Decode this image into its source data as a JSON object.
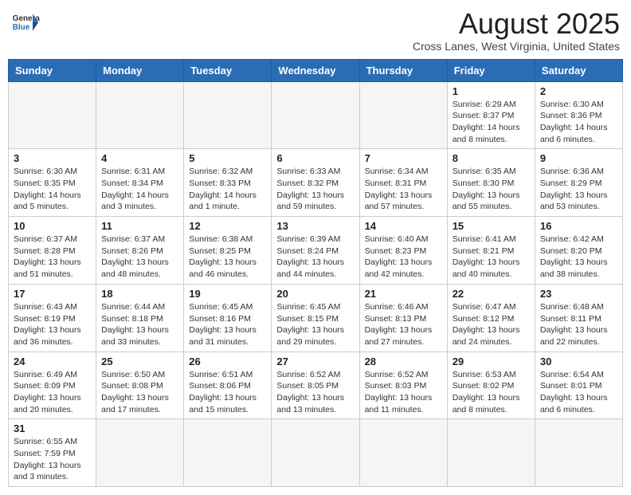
{
  "header": {
    "logo_line1": "General",
    "logo_line2": "Blue",
    "title": "August 2025",
    "subtitle": "Cross Lanes, West Virginia, United States"
  },
  "days_of_week": [
    "Sunday",
    "Monday",
    "Tuesday",
    "Wednesday",
    "Thursday",
    "Friday",
    "Saturday"
  ],
  "weeks": [
    [
      {
        "day": "",
        "info": ""
      },
      {
        "day": "",
        "info": ""
      },
      {
        "day": "",
        "info": ""
      },
      {
        "day": "",
        "info": ""
      },
      {
        "day": "",
        "info": ""
      },
      {
        "day": "1",
        "info": "Sunrise: 6:29 AM\nSunset: 8:37 PM\nDaylight: 14 hours and 8 minutes."
      },
      {
        "day": "2",
        "info": "Sunrise: 6:30 AM\nSunset: 8:36 PM\nDaylight: 14 hours and 6 minutes."
      }
    ],
    [
      {
        "day": "3",
        "info": "Sunrise: 6:30 AM\nSunset: 8:35 PM\nDaylight: 14 hours and 5 minutes."
      },
      {
        "day": "4",
        "info": "Sunrise: 6:31 AM\nSunset: 8:34 PM\nDaylight: 14 hours and 3 minutes."
      },
      {
        "day": "5",
        "info": "Sunrise: 6:32 AM\nSunset: 8:33 PM\nDaylight: 14 hours and 1 minute."
      },
      {
        "day": "6",
        "info": "Sunrise: 6:33 AM\nSunset: 8:32 PM\nDaylight: 13 hours and 59 minutes."
      },
      {
        "day": "7",
        "info": "Sunrise: 6:34 AM\nSunset: 8:31 PM\nDaylight: 13 hours and 57 minutes."
      },
      {
        "day": "8",
        "info": "Sunrise: 6:35 AM\nSunset: 8:30 PM\nDaylight: 13 hours and 55 minutes."
      },
      {
        "day": "9",
        "info": "Sunrise: 6:36 AM\nSunset: 8:29 PM\nDaylight: 13 hours and 53 minutes."
      }
    ],
    [
      {
        "day": "10",
        "info": "Sunrise: 6:37 AM\nSunset: 8:28 PM\nDaylight: 13 hours and 51 minutes."
      },
      {
        "day": "11",
        "info": "Sunrise: 6:37 AM\nSunset: 8:26 PM\nDaylight: 13 hours and 48 minutes."
      },
      {
        "day": "12",
        "info": "Sunrise: 6:38 AM\nSunset: 8:25 PM\nDaylight: 13 hours and 46 minutes."
      },
      {
        "day": "13",
        "info": "Sunrise: 6:39 AM\nSunset: 8:24 PM\nDaylight: 13 hours and 44 minutes."
      },
      {
        "day": "14",
        "info": "Sunrise: 6:40 AM\nSunset: 8:23 PM\nDaylight: 13 hours and 42 minutes."
      },
      {
        "day": "15",
        "info": "Sunrise: 6:41 AM\nSunset: 8:21 PM\nDaylight: 13 hours and 40 minutes."
      },
      {
        "day": "16",
        "info": "Sunrise: 6:42 AM\nSunset: 8:20 PM\nDaylight: 13 hours and 38 minutes."
      }
    ],
    [
      {
        "day": "17",
        "info": "Sunrise: 6:43 AM\nSunset: 8:19 PM\nDaylight: 13 hours and 36 minutes."
      },
      {
        "day": "18",
        "info": "Sunrise: 6:44 AM\nSunset: 8:18 PM\nDaylight: 13 hours and 33 minutes."
      },
      {
        "day": "19",
        "info": "Sunrise: 6:45 AM\nSunset: 8:16 PM\nDaylight: 13 hours and 31 minutes."
      },
      {
        "day": "20",
        "info": "Sunrise: 6:45 AM\nSunset: 8:15 PM\nDaylight: 13 hours and 29 minutes."
      },
      {
        "day": "21",
        "info": "Sunrise: 6:46 AM\nSunset: 8:13 PM\nDaylight: 13 hours and 27 minutes."
      },
      {
        "day": "22",
        "info": "Sunrise: 6:47 AM\nSunset: 8:12 PM\nDaylight: 13 hours and 24 minutes."
      },
      {
        "day": "23",
        "info": "Sunrise: 6:48 AM\nSunset: 8:11 PM\nDaylight: 13 hours and 22 minutes."
      }
    ],
    [
      {
        "day": "24",
        "info": "Sunrise: 6:49 AM\nSunset: 8:09 PM\nDaylight: 13 hours and 20 minutes."
      },
      {
        "day": "25",
        "info": "Sunrise: 6:50 AM\nSunset: 8:08 PM\nDaylight: 13 hours and 17 minutes."
      },
      {
        "day": "26",
        "info": "Sunrise: 6:51 AM\nSunset: 8:06 PM\nDaylight: 13 hours and 15 minutes."
      },
      {
        "day": "27",
        "info": "Sunrise: 6:52 AM\nSunset: 8:05 PM\nDaylight: 13 hours and 13 minutes."
      },
      {
        "day": "28",
        "info": "Sunrise: 6:52 AM\nSunset: 8:03 PM\nDaylight: 13 hours and 11 minutes."
      },
      {
        "day": "29",
        "info": "Sunrise: 6:53 AM\nSunset: 8:02 PM\nDaylight: 13 hours and 8 minutes."
      },
      {
        "day": "30",
        "info": "Sunrise: 6:54 AM\nSunset: 8:01 PM\nDaylight: 13 hours and 6 minutes."
      }
    ],
    [
      {
        "day": "31",
        "info": "Sunrise: 6:55 AM\nSunset: 7:59 PM\nDaylight: 13 hours and 3 minutes."
      },
      {
        "day": "",
        "info": ""
      },
      {
        "day": "",
        "info": ""
      },
      {
        "day": "",
        "info": ""
      },
      {
        "day": "",
        "info": ""
      },
      {
        "day": "",
        "info": ""
      },
      {
        "day": "",
        "info": ""
      }
    ]
  ]
}
